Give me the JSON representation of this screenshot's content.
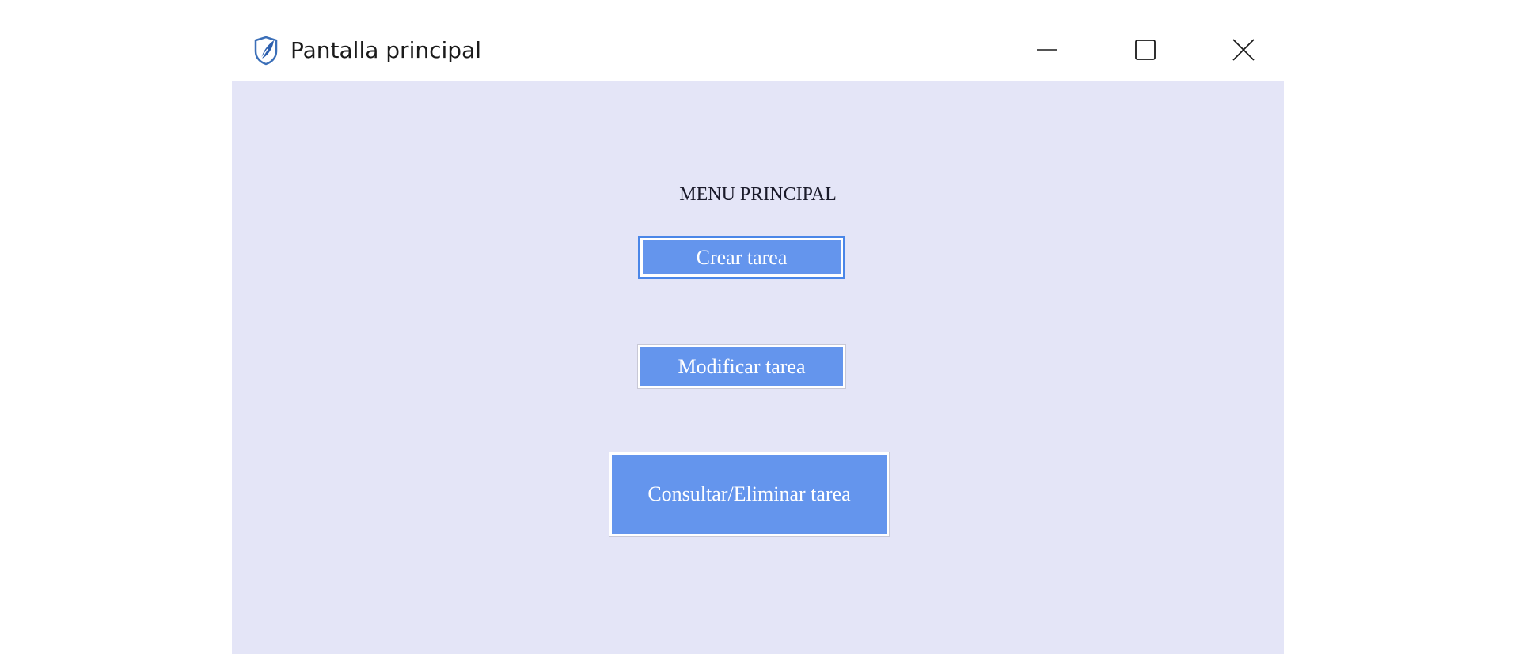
{
  "window": {
    "title": "Pantalla principal",
    "icon": "shield-feather-icon",
    "controls": {
      "minimize_icon": "minimize-icon",
      "maximize_icon": "maximize-icon",
      "close_icon": "close-icon"
    }
  },
  "main": {
    "heading": "MENU PRINCIPAL",
    "buttons": {
      "crear": "Crear tarea",
      "modificar": "Modificar tarea",
      "consultar": "Consultar/Eliminar tarea"
    }
  },
  "colors": {
    "background": "#e4e5f7",
    "button": "#6495ed",
    "button_text": "#ffffff",
    "focus_border": "#4a86e8"
  }
}
